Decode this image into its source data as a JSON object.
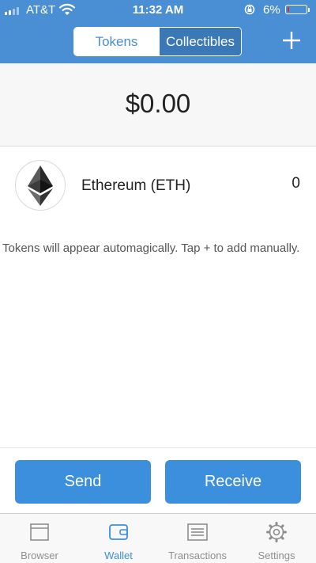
{
  "status_bar": {
    "carrier": "AT&T",
    "time": "11:32 AM",
    "battery_percent": "6%",
    "battery_level": 0.06,
    "icons": [
      "signal-icon",
      "wifi-icon",
      "orientation-lock-icon",
      "battery-icon"
    ]
  },
  "header": {
    "tabs": [
      {
        "label": "Tokens",
        "active": true
      },
      {
        "label": "Collectibles",
        "active": false
      }
    ],
    "add_icon": "plus-icon"
  },
  "balance": {
    "total": "$0.00"
  },
  "tokens": [
    {
      "name": "Ethereum (ETH)",
      "balance": "0",
      "icon": "ethereum-icon"
    }
  ],
  "hint": "Tokens will appear automagically. Tap + to add manually.",
  "actions": {
    "send_label": "Send",
    "receive_label": "Receive"
  },
  "tab_bar": {
    "items": [
      {
        "label": "Browser",
        "icon": "browser-icon",
        "active": false
      },
      {
        "label": "Wallet",
        "icon": "wallet-icon",
        "active": true
      },
      {
        "label": "Transactions",
        "icon": "transactions-icon",
        "active": false
      },
      {
        "label": "Settings",
        "icon": "gear-icon",
        "active": false
      }
    ]
  },
  "colors": {
    "header_blue": "#4a8fd3",
    "button_blue": "#3b8fdc",
    "battery_low": "#e0262d"
  }
}
